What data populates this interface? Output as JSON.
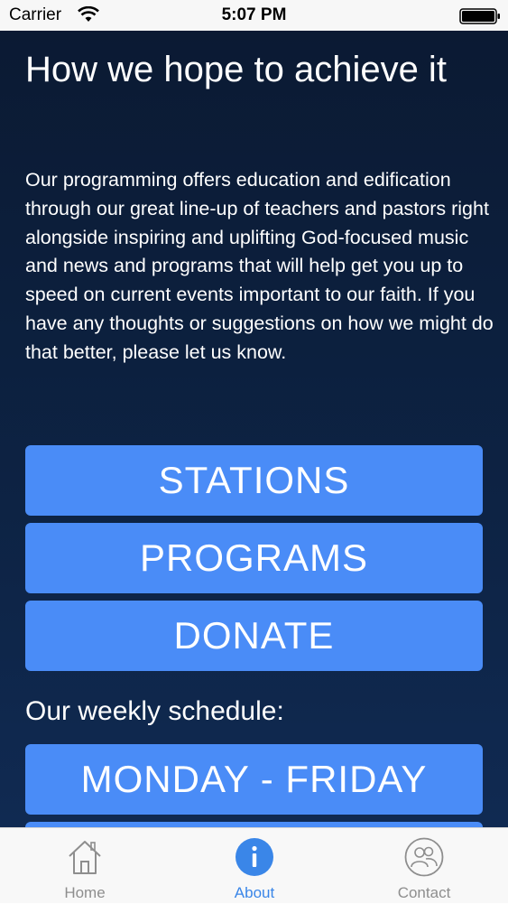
{
  "status_bar": {
    "carrier": "Carrier",
    "time": "5:07 PM",
    "icons": [
      "wifi-icon",
      "battery-icon"
    ]
  },
  "main": {
    "title": "How we hope to achieve it",
    "intro": "Our programming offers education and edification through our great line-up of teachers and pastors right alongside inspiring and uplifting God-focused music and news and programs that will help get you up to speed on current events important to our faith. If you have any thoughts or suggestions on how we might do that better, please let us know.",
    "buttons": {
      "stations": "STATIONS",
      "programs": "PROGRAMS",
      "donate": "DONATE"
    },
    "schedule_heading": "Our weekly schedule:",
    "schedule_buttons": {
      "monday_friday": "MONDAY - FRIDAY"
    }
  },
  "tab_bar": {
    "tabs": [
      {
        "label": "Home",
        "icon": "home-icon"
      },
      {
        "label": "About",
        "icon": "info-icon",
        "selected": true
      },
      {
        "label": "Contact",
        "icon": "contacts-icon"
      }
    ]
  },
  "colors": {
    "button_blue": "#4a8cf7",
    "background_navy": "#0d2344",
    "active_tab_blue": "#3a86e8",
    "inactive_tab_gray": "#8e8e8e"
  }
}
